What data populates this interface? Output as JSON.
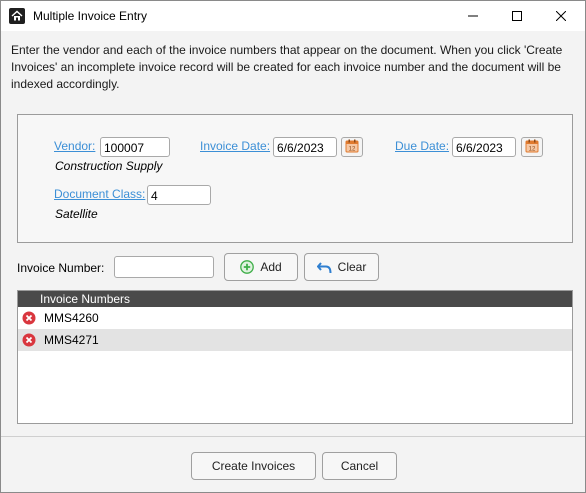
{
  "window": {
    "title": "Multiple Invoice Entry",
    "app_icon": "house-logo-icon",
    "controls": [
      "minimize-icon",
      "maximize-icon",
      "close-icon"
    ]
  },
  "description": "Enter the vendor and each of the invoice numbers that appear on the document. When you click 'Create Invoices' an incomplete invoice record will be created for each invoice number and the document will be indexed accordingly.",
  "vendor": {
    "label": "Vendor:",
    "value": "100007",
    "name": "Construction Supply"
  },
  "invoice_date": {
    "label": "Invoice Date:",
    "value": "6/6/2023"
  },
  "due_date": {
    "label": "Due Date:",
    "value": "6/6/2023"
  },
  "document_class": {
    "label": "Document Class:",
    "value": "4",
    "name": "Satellite"
  },
  "invoice_entry": {
    "label": "Invoice Number:",
    "value": "",
    "add_label": "Add",
    "clear_label": "Clear"
  },
  "grid": {
    "header": "Invoice Numbers",
    "rows": [
      "MMS4260",
      "MMS4271"
    ]
  },
  "footer": {
    "create_label": "Create Invoices",
    "cancel_label": "Cancel"
  },
  "colors": {
    "link": "#3c8fd6",
    "grid_header_bg": "#4a4a4a",
    "delete_icon": "#d9363e",
    "add_icon": "#3fae49",
    "calendar_icon": "#e07a2e"
  }
}
